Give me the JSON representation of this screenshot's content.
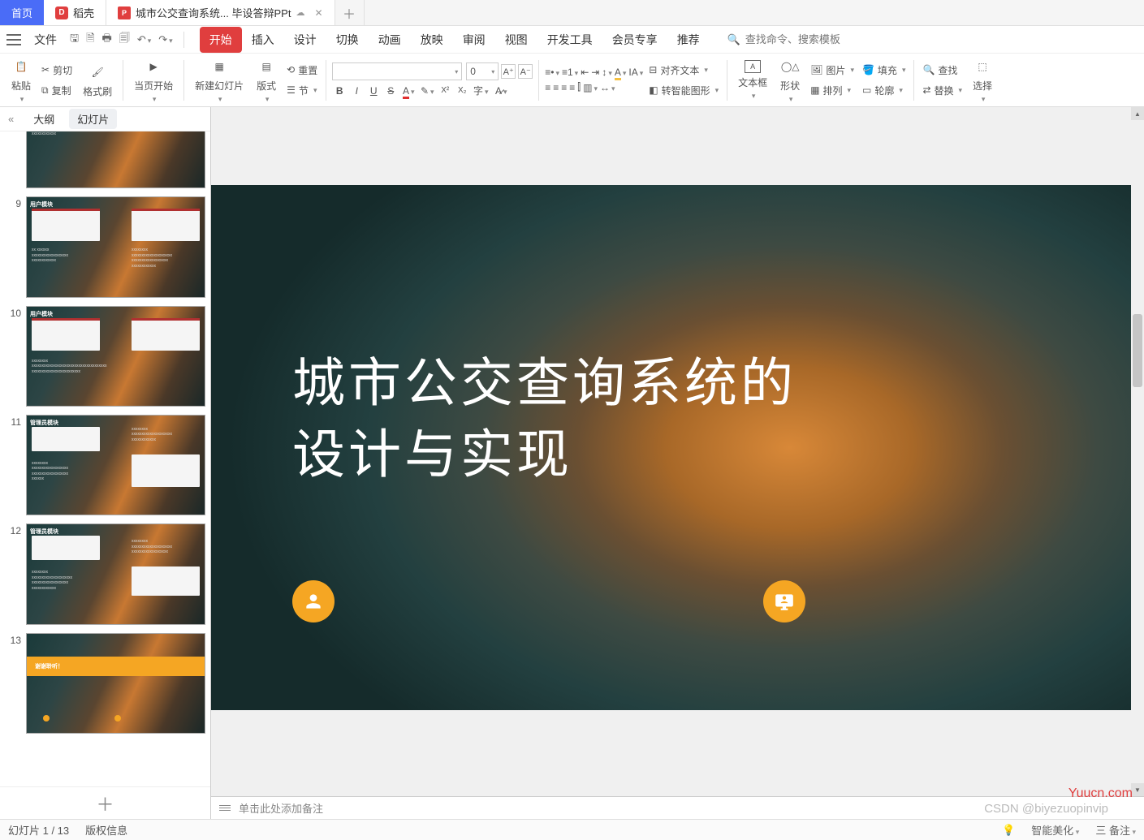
{
  "tabs": {
    "home": "首页",
    "docker": "稻壳",
    "doc": "城市公交查询系统... 毕设答辩PPt"
  },
  "file_label": "文件",
  "search_placeholder": "查找命令、搜索模板",
  "ribbon_tabs": [
    "开始",
    "插入",
    "设计",
    "切换",
    "动画",
    "放映",
    "审阅",
    "视图",
    "开发工具",
    "会员专享",
    "推荐"
  ],
  "ribbon": {
    "paste": "粘贴",
    "cut": "剪切",
    "copy": "复制",
    "format_painter": "格式刷",
    "from_current": "当页开始",
    "new_slide": "新建幻灯片",
    "layout": "版式",
    "section": "节",
    "reset": "重置",
    "font_size_val": "0",
    "align_text": "对齐文本",
    "convert_smart": "转智能图形",
    "textbox": "文本框",
    "shape": "形状",
    "picture": "图片",
    "arrange": "排列",
    "fill": "填充",
    "outline": "轮廓",
    "find": "查找",
    "replace": "替换",
    "select": "选择"
  },
  "thumb_header": {
    "outline": "大纲",
    "slides": "幻灯片"
  },
  "thumbs": [
    {
      "num": "9",
      "title": "用户模块"
    },
    {
      "num": "10",
      "title": "用户模块"
    },
    {
      "num": "11",
      "title": "管理员模块"
    },
    {
      "num": "12",
      "title": "管理员模块"
    },
    {
      "num": "13",
      "title": "谢谢聆听！"
    }
  ],
  "slide": {
    "title_line1": "城市公交查询系统的",
    "title_line2": "设计与实现"
  },
  "notes_placeholder": "单击此处添加备注",
  "status": {
    "page": "幻灯片 1 / 13",
    "copyright": "版权信息",
    "smart_beauty": "智能美化",
    "notes": "备注"
  },
  "watermark_site": "Yuucn.com",
  "watermark_csdn": "CSDN @biyezuopinvip"
}
